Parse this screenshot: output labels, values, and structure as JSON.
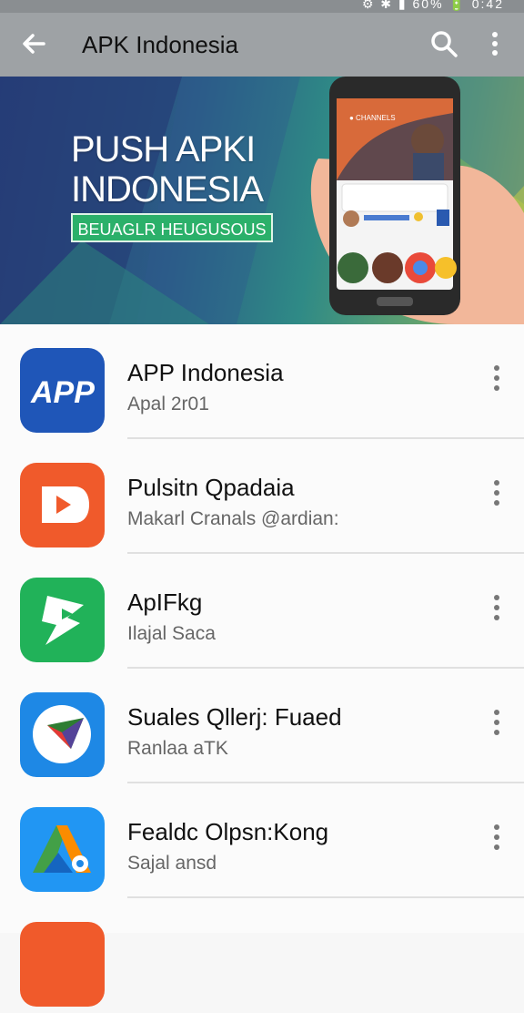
{
  "status_bar": {
    "right_text": "⚙ ✱ ▮ 60% 🔋 0:42"
  },
  "app_bar": {
    "title": "APK Indonesia",
    "back_icon": "arrow-back-icon",
    "search_icon": "search-icon",
    "more_icon": "more-vert-icon"
  },
  "banner": {
    "headline_1": "PUSH APKI",
    "headline_2": "INDONESIA",
    "tag": "BEUAGLR HEUGUSOUS",
    "phone_brand_text": "● CHANNELS"
  },
  "apps": [
    {
      "name": "APP Indonesia",
      "subtitle": "Apal 2r01",
      "icon_text": "APP",
      "icon_color": "#1f56b8"
    },
    {
      "name": "Pulsitn Qpadaia",
      "subtitle": "Makarl Cranals @ardian:",
      "icon_color": "#f05a2b"
    },
    {
      "name": "ApIFkg",
      "subtitle": "Ilajal Saca",
      "icon_color": "#21b259"
    },
    {
      "name": "Suales Qllerj: Fuaed",
      "subtitle": "Ranlaa aTK",
      "icon_color": "#1e88e5"
    },
    {
      "name": "Fealdc Olpsn:Kong",
      "subtitle": "Sajal ansd",
      "icon_color": "#2196f3"
    }
  ]
}
